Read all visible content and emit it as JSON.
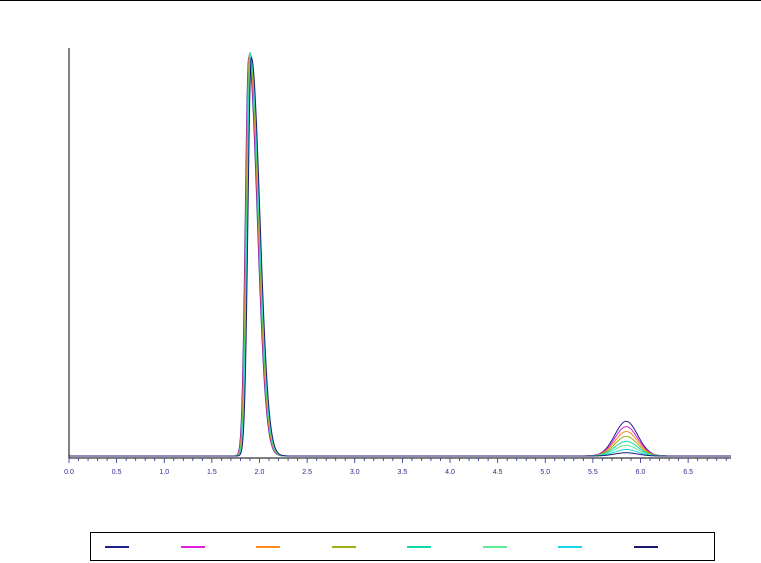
{
  "chart_data": {
    "type": "line",
    "xlim": [
      0.0,
      6.95
    ],
    "ylim": [
      0,
      1.0
    ],
    "x_ticks": [
      "0.0",
      "0.5",
      "1.0",
      "1.5",
      "2.0",
      "2.5",
      "3.0",
      "3.5",
      "4.0",
      "4.5",
      "5.0",
      "5.5",
      "6.0",
      "6.5"
    ],
    "grid": false,
    "legend_placement": "bottom",
    "main_peak": {
      "center": 1.9,
      "height": 0.99,
      "sigma_left": 0.035,
      "sigma_right": 0.09
    },
    "series": [
      {
        "color": "#1f1f8c",
        "peak2_height": 0.085
      },
      {
        "color": "#e21ce2",
        "peak2_height": 0.072
      },
      {
        "color": "#ff8c1a",
        "peak2_height": 0.06
      },
      {
        "color": "#a0b010",
        "peak2_height": 0.048
      },
      {
        "color": "#10d8a8",
        "peak2_height": 0.036
      },
      {
        "color": "#60e890",
        "peak2_height": 0.026
      },
      {
        "color": "#18d8e8",
        "peak2_height": 0.016
      },
      {
        "color": "#1a1a70",
        "peak2_height": 0.008
      }
    ],
    "peak2": {
      "center": 5.85,
      "sigma": 0.12
    },
    "baseline": 0.0
  }
}
